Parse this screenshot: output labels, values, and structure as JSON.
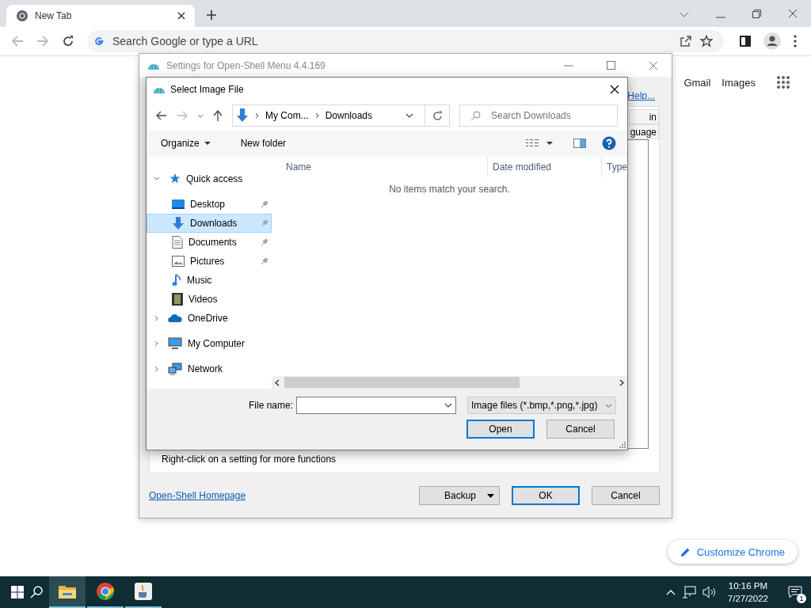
{
  "browser": {
    "tab": {
      "title": "New Tab"
    },
    "omnibox": {
      "placeholder": "Search Google or type a URL"
    }
  },
  "page": {
    "links": [
      "Gmail",
      "Images"
    ],
    "customize_button": "Customize Chrome"
  },
  "settings_window": {
    "title": "Settings for Open-Shell Menu 4.4.169",
    "help_link": "Help...",
    "tabs": [
      "in",
      "guage"
    ],
    "hint": "Right-click on a setting for more functions",
    "homepage_link": "Open-Shell Homepage",
    "buttons": [
      {
        "label": "Backup",
        "kind": "split"
      },
      {
        "label": "OK",
        "kind": "default"
      },
      {
        "label": "Cancel",
        "kind": "plain"
      }
    ]
  },
  "file_dialog": {
    "title": "Select Image File",
    "breadcrumb": [
      "My Com...",
      "Downloads"
    ],
    "search": {
      "placeholder": "Search Downloads"
    },
    "commands": [
      "Organize",
      "New folder"
    ],
    "nav": [
      {
        "label": "Quick access",
        "kind": "star",
        "expanded": true,
        "selected": false,
        "children": [
          {
            "label": "Desktop",
            "kind": "desktop",
            "pinned": true,
            "selected": false
          },
          {
            "label": "Downloads",
            "kind": "download",
            "pinned": true,
            "selected": true
          },
          {
            "label": "Documents",
            "kind": "document",
            "pinned": true,
            "selected": false
          },
          {
            "label": "Pictures",
            "kind": "picture",
            "pinned": true,
            "selected": false
          },
          {
            "label": "Music",
            "kind": "music",
            "pinned": false,
            "selected": false
          },
          {
            "label": "Videos",
            "kind": "video",
            "pinned": false,
            "selected": false
          }
        ]
      },
      {
        "label": "OneDrive",
        "kind": "cloud",
        "expanded": false,
        "selected": false
      },
      {
        "label": "My Computer",
        "kind": "computer",
        "expanded": false,
        "selected": false
      },
      {
        "label": "Network",
        "kind": "network",
        "expanded": false,
        "selected": false
      }
    ],
    "columns": [
      "Name",
      "Date modified",
      "Type"
    ],
    "empty_message": "No items match your search.",
    "file_name_label": "File name:",
    "file_type": "Image files (*.bmp,*.png,*.jpg)",
    "buttons": [
      {
        "label": "Open",
        "kind": "default"
      },
      {
        "label": "Cancel",
        "kind": "plain"
      }
    ]
  },
  "taskbar": {
    "apps": [
      {
        "kind": "explorer",
        "selected": true
      },
      {
        "kind": "browser",
        "selected": false
      },
      {
        "kind": "java",
        "selected": false
      }
    ],
    "time": "10:16 PM",
    "date": "7/27/2022",
    "notification_count": "1"
  }
}
